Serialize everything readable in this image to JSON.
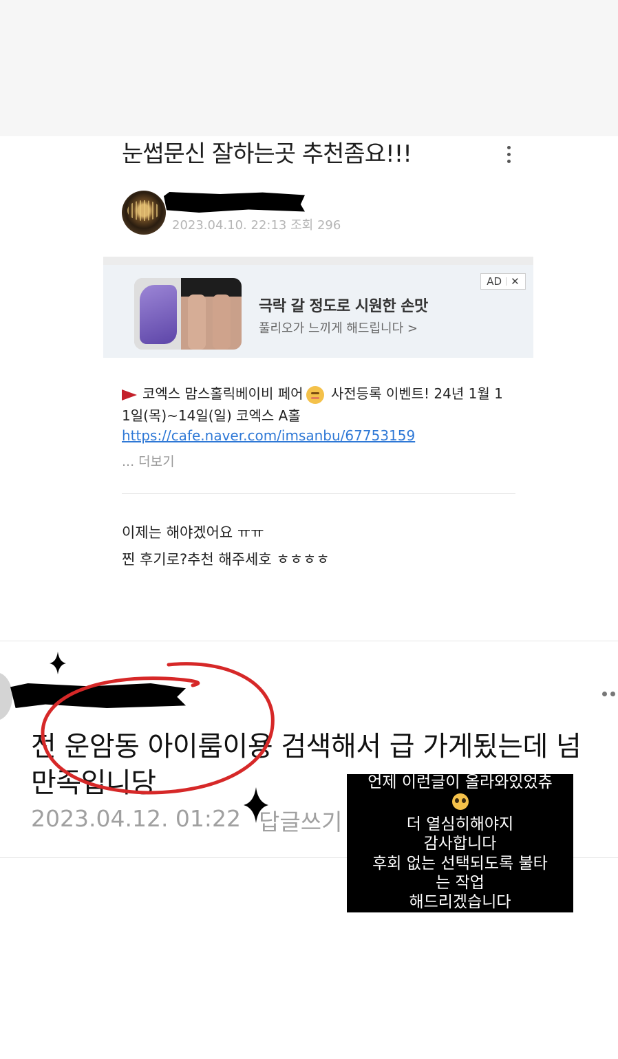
{
  "post": {
    "title": "눈썹문신 잘하는곳 추천좀요!!!",
    "meta": "2023.04.10. 22:13 조회 296"
  },
  "ad": {
    "title": "극락 갈 정도로 시원한 손맛",
    "subtitle": "풀리오가 느끼게 해드립니다 >",
    "badge": "AD",
    "close_icon": "✕"
  },
  "notice": {
    "line1_a": "코엑스 맘스홀릭베이비 페어",
    "line1_b": "사전등록 이벤트! 24년 1월 1",
    "line2": "1일(목)~14일(일) 코엑스 A홀",
    "link": "https://cafe.naver.com/imsanbu/67753159",
    "more": "... 더보기"
  },
  "body": {
    "line1": "이제는 해야겠어요 ㅠㅠ",
    "line2": "찐 후기로?추천  해주세호 ㅎㅎㅎㅎ"
  },
  "comment": {
    "line1": "전 운암동 아이룸이용 검색해서 급 가게됬는데 넘",
    "line2": "만족입니당",
    "date": "2023.04.12. 01:22",
    "reply": "답글쓰기"
  },
  "overlay": {
    "lines": [
      "언제 이런글이 올라와있었츄",
      "더 열심히해야지",
      "감사합니다",
      "후회 없는 선택되도록 불타",
      "는 작업",
      "해드리겠습니다"
    ]
  },
  "colors": {
    "circle": "#d62828",
    "link": "#2e78d6",
    "overlay_bg": "#000000"
  },
  "icons": [
    "more-vertical-icon",
    "close-icon",
    "flag-icon",
    "baby-emoji-icon",
    "more-horizontal-icon",
    "sparkle-icon",
    "pleading-emoji-icon"
  ]
}
